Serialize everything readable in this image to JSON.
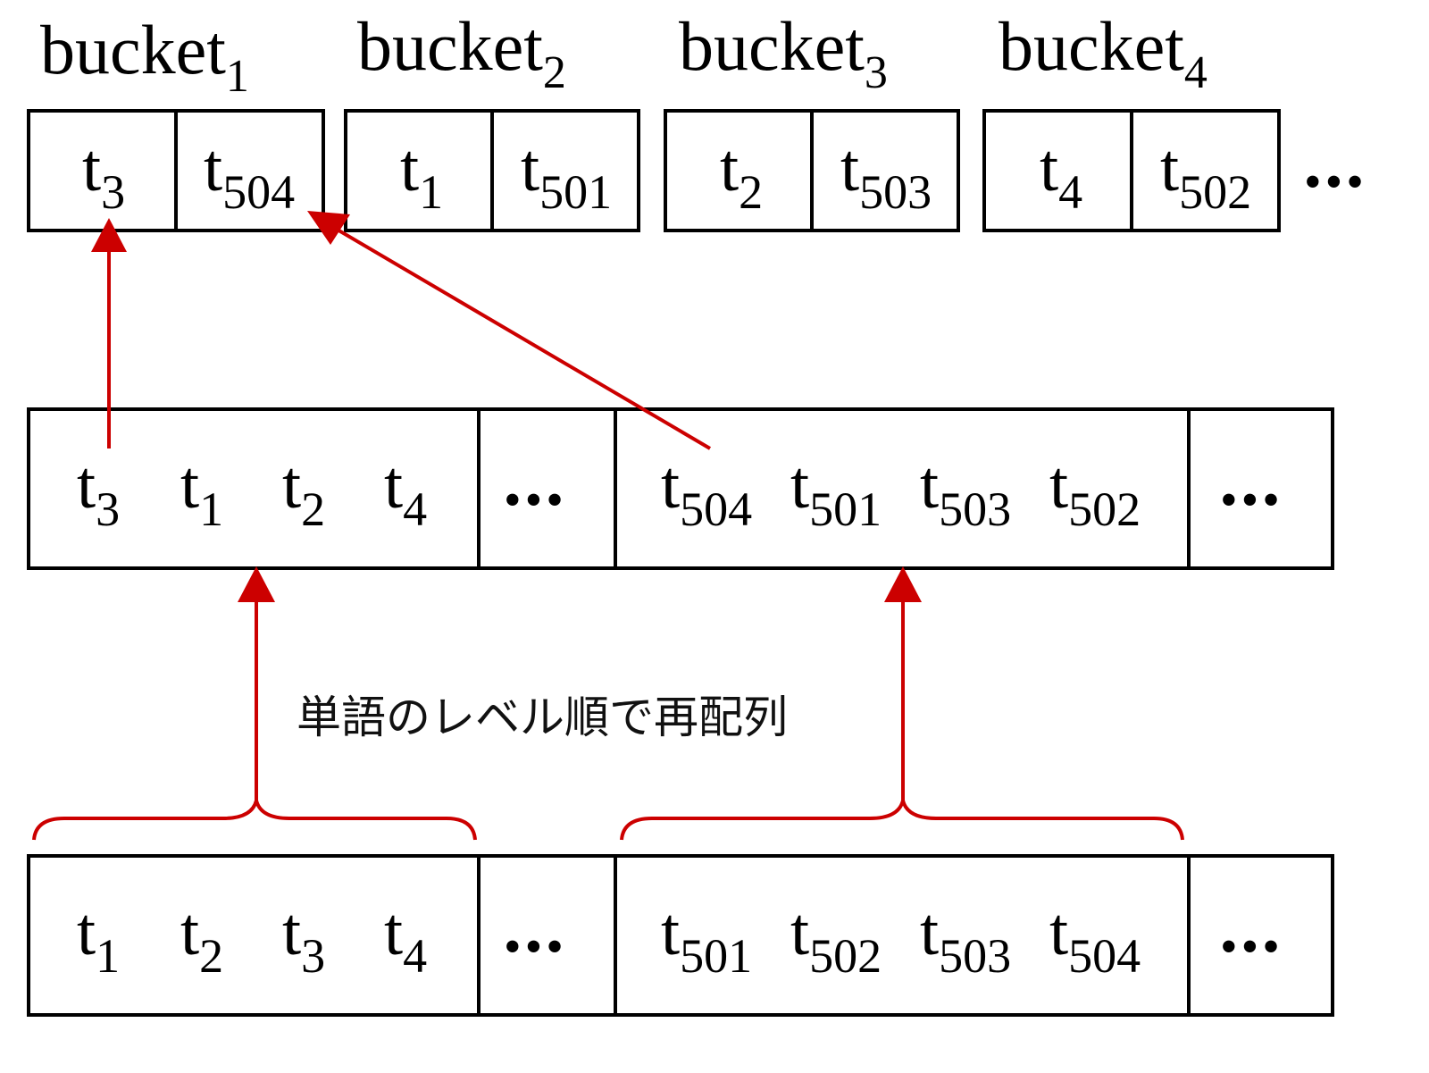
{
  "buckets": [
    {
      "name": "bucket",
      "sub": "1",
      "cells": [
        {
          "t": "t",
          "s": "3"
        },
        {
          "t": "t",
          "s": "504"
        }
      ]
    },
    {
      "name": "bucket",
      "sub": "2",
      "cells": [
        {
          "t": "t",
          "s": "1"
        },
        {
          "t": "t",
          "s": "501"
        }
      ]
    },
    {
      "name": "bucket",
      "sub": "3",
      "cells": [
        {
          "t": "t",
          "s": "2"
        },
        {
          "t": "t",
          "s": "503"
        }
      ]
    },
    {
      "name": "bucket",
      "sub": "4",
      "cells": [
        {
          "t": "t",
          "s": "4"
        },
        {
          "t": "t",
          "s": "502"
        }
      ]
    }
  ],
  "bucket_more": "•••",
  "middle_row": {
    "group1": [
      {
        "t": "t",
        "s": "3"
      },
      {
        "t": "t",
        "s": "1"
      },
      {
        "t": "t",
        "s": "2"
      },
      {
        "t": "t",
        "s": "4"
      }
    ],
    "gap1": "•••",
    "group2": [
      {
        "t": "t",
        "s": "504"
      },
      {
        "t": "t",
        "s": "501"
      },
      {
        "t": "t",
        "s": "503"
      },
      {
        "t": "t",
        "s": "502"
      }
    ],
    "gap2": "•••"
  },
  "bottom_row": {
    "group1": [
      {
        "t": "t",
        "s": "1"
      },
      {
        "t": "t",
        "s": "2"
      },
      {
        "t": "t",
        "s": "3"
      },
      {
        "t": "t",
        "s": "4"
      }
    ],
    "gap1": "•••",
    "group2": [
      {
        "t": "t",
        "s": "501"
      },
      {
        "t": "t",
        "s": "502"
      },
      {
        "t": "t",
        "s": "503"
      },
      {
        "t": "t",
        "s": "504"
      }
    ],
    "gap2": "•••"
  },
  "caption": "単語のレベル順で再配列",
  "colors": {
    "arrow": "#cc0000",
    "line": "#000000"
  }
}
